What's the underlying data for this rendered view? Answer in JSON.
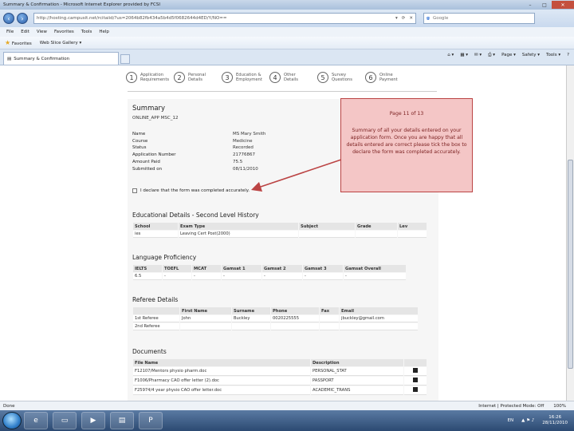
{
  "window": {
    "title": "Summary & Confirmation - Microsoft Internet Explorer provided by FCSI"
  },
  "address": {
    "url": "http://hosting.campusit.net/rcitaiid/?us=2064b82fb434a5b4d5f0682644d4ED/Y/NO==",
    "search_placeholder": "Google"
  },
  "menu": [
    "File",
    "Edit",
    "View",
    "Favorites",
    "Tools",
    "Help"
  ],
  "favorites": {
    "label": "Favorites",
    "gallery": "Web Slice Gallery ▾"
  },
  "tab": {
    "label": "Summary & Confirmation"
  },
  "commandbar": [
    "Page ▾",
    "Safety ▾",
    "Tools ▾"
  ],
  "steps": [
    {
      "num": "1",
      "line1": "Application",
      "line2": "Requirements"
    },
    {
      "num": "2",
      "line1": "Personal",
      "line2": "Details"
    },
    {
      "num": "3",
      "line1": "Education &",
      "line2": "Employment"
    },
    {
      "num": "4",
      "line1": "Other",
      "line2": "Details"
    },
    {
      "num": "5",
      "line1": "Survey",
      "line2": "Questions"
    },
    {
      "num": "6",
      "line1": "Online",
      "line2": "Payment"
    }
  ],
  "summary": {
    "title": "Summary",
    "subtitle": "ONLINE_APP MSC_12",
    "fields": [
      {
        "k": "Name",
        "v": "MS Mary Smith"
      },
      {
        "k": "Course",
        "v": "Medicine"
      },
      {
        "k": "Status",
        "v": "Recorded"
      },
      {
        "k": "Application Number",
        "v": "21776867"
      },
      {
        "k": "Amount Paid",
        "v": "75.5"
      },
      {
        "k": "Submitted on",
        "v": "08/11/2010"
      }
    ],
    "declaration": "I declare that the form was completed accurately."
  },
  "education": {
    "title": "Educational Details - Second Level History",
    "headers": [
      "School",
      "Exam Type",
      "Subject",
      "Grade",
      "Lev"
    ],
    "rows": [
      [
        "ies",
        "Leaving Cert Post(2000)",
        "",
        "",
        ""
      ]
    ]
  },
  "language": {
    "title": "Language Proficiency",
    "headers": [
      "IELTS",
      "TOEFL",
      "MCAT",
      "Gamsat 1",
      "Gamsat 2",
      "Gamsat 3",
      "Gamsat Overall"
    ],
    "rows": [
      [
        "6.5",
        "-",
        "-",
        "-",
        "-",
        "-",
        "-"
      ]
    ]
  },
  "referee": {
    "title": "Referee Details",
    "headers": [
      "",
      "First Name",
      "Surname",
      "Phone",
      "Fax",
      "Email"
    ],
    "rows": [
      [
        "1st Referee",
        "John",
        "Buckley",
        "0020225555",
        "",
        "jbuckley@gmail.com"
      ],
      [
        "2nd Referee",
        "",
        "",
        "",
        "",
        ""
      ]
    ]
  },
  "documents": {
    "title": "Documents",
    "headers": [
      "File Name",
      "Description",
      ""
    ],
    "rows": [
      [
        "F12107/Mentors physio pharm.doc",
        "PERSONAL_STAT"
      ],
      [
        "F1006/Pharmacy CAO offer letter (2).doc",
        "PASSPORT"
      ],
      [
        "F25974/4 year physio CAO offer letter.doc",
        "ACADEMIC_TRANS"
      ]
    ]
  },
  "callout": {
    "page": "Page 11 of 13",
    "text": "Summary of all your details entered on your application form. Once you are happy that all details entered are correct please tick the box to declare the form was completed accurately."
  },
  "status": {
    "left": "Done",
    "zone": "Internet | Protected Mode: Off",
    "zoom": "100%"
  },
  "taskbar": {
    "lang": "EN",
    "time": "16:26",
    "date": "28/11/2010"
  }
}
